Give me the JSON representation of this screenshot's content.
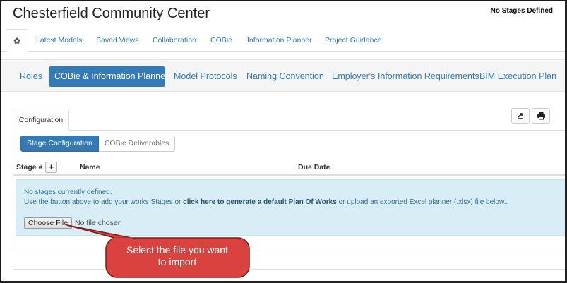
{
  "app": {
    "title": "Chesterfield Community Center",
    "stage_status": "No Stages Defined"
  },
  "top_tabs": [
    {
      "label": "Latest Models"
    },
    {
      "label": "Saved Views"
    },
    {
      "label": "Collaboration"
    },
    {
      "label": "COBie"
    },
    {
      "label": "Information Planner"
    },
    {
      "label": "Project Guidance"
    }
  ],
  "top_tabs_settings_icon": "gear-icon",
  "sub_nav": [
    {
      "label": "Roles",
      "active": false
    },
    {
      "label": "COBie & Information Planner",
      "active": true
    },
    {
      "label": "Model Protocols",
      "active": false
    },
    {
      "label": "Naming Convention",
      "active": false
    },
    {
      "label": "Employer's Information Requirements",
      "active": false
    },
    {
      "label": "BIM Execution Plan",
      "active": false
    }
  ],
  "panel": {
    "tab_label": "Configuration",
    "export_icon": "export-icon",
    "print_icon": "print-icon",
    "toggle": {
      "active_label": "Stage Configuration",
      "inactive_label": "COBie Deliverables"
    },
    "table": {
      "columns": [
        "Stage #",
        "Name",
        "Due Date"
      ],
      "add_label": "+"
    },
    "info": {
      "line1": "No stages currently defined.",
      "line2_before": "Use the button above to add your works Stages or ",
      "line2_link": "click here to generate a default Plan Of Works",
      "line2_after": " or upload an exported Excel planner (.xlsx) file below..",
      "file_button": "Choose File",
      "file_status": "No file chosen"
    }
  },
  "callout": {
    "line1": "Select the file you want",
    "line2": "to import"
  },
  "colors": {
    "accent": "#337ab7",
    "info_bg": "#d9edf7",
    "callout_fill": "#d9423e",
    "callout_border": "#7a1a16"
  }
}
